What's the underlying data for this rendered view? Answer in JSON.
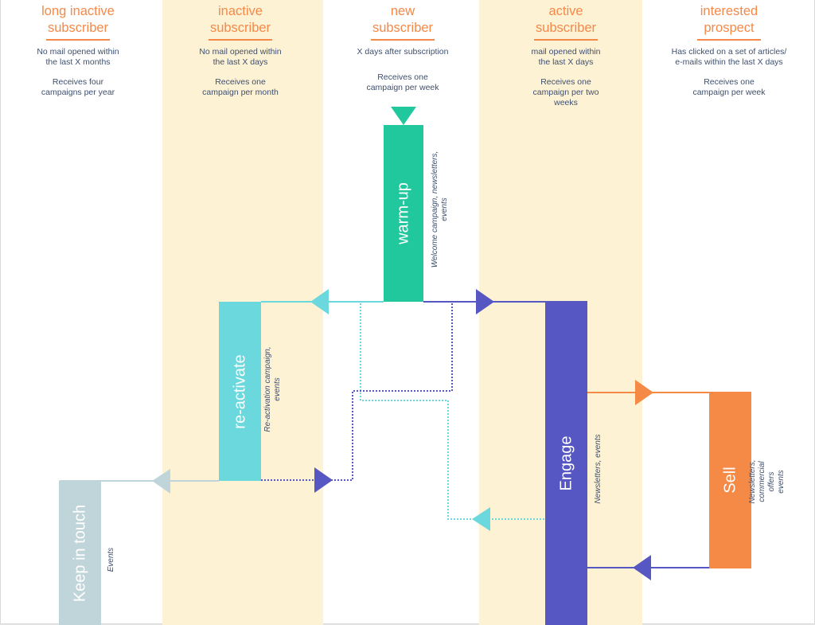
{
  "colors": {
    "lane_highlight": "#fef2d4",
    "title_orange": "#f4894a",
    "text_navy": "#3d4f6f",
    "warmup_green": "#22c89d",
    "reactivate_cyan": "#6ad8dc",
    "engage_purple": "#5657c2",
    "sell_orange": "#f48a45",
    "keep_grey": "#c0d5da"
  },
  "lanes": [
    {
      "id": "long-inactive",
      "title": "long inactive\nsubscriber",
      "title_l1": "long inactive",
      "title_l2": "subscriber",
      "criteria": "No mail opened within\nthe last X months",
      "frequency": "Receives four\ncampaigns per year"
    },
    {
      "id": "inactive",
      "title_l1": "inactive",
      "title_l2": "subscriber",
      "criteria": "No mail opened within\nthe last X days",
      "frequency": "Receives one\ncampaign per month"
    },
    {
      "id": "new",
      "title_l1": "new",
      "title_l2": "subscriber",
      "criteria": "X days after subscription",
      "frequency": "Receives one\ncampaign per week"
    },
    {
      "id": "active",
      "title_l1": "active",
      "title_l2": "subscriber",
      "criteria": "mail opened within\nthe last X days",
      "frequency": "Receives one\ncampaign per two\nweeks"
    },
    {
      "id": "interested",
      "title_l1": "interested",
      "title_l2": "prospect",
      "criteria": "Has clicked on a set of articles/\ne-mails within the last X days",
      "frequency": "Receives one\ncampaign per week"
    }
  ],
  "stages": {
    "warmup": {
      "label": "warm-up",
      "note": "Welcome campaign, newsletters,\nevents"
    },
    "reactivate": {
      "label": "re-activate",
      "note": "Re-activation campaign,\nevents"
    },
    "engage": {
      "label": "Engage",
      "note": "Newsletters,  events"
    },
    "sell": {
      "label": "Sell",
      "note": "Newsletters,  commercial offers\nevents"
    },
    "keep": {
      "label": "Keep in touch",
      "note": "Events"
    }
  },
  "flows": [
    {
      "from": "entry",
      "to": "warm-up",
      "style": "arrow-in"
    },
    {
      "from": "warm-up",
      "to": "re-activate",
      "style": "solid"
    },
    {
      "from": "warm-up",
      "to": "engage",
      "style": "solid"
    },
    {
      "from": "warm-up",
      "to": "re-activate",
      "style": "dotted"
    },
    {
      "from": "re-activate",
      "to": "engage",
      "style": "dotted"
    },
    {
      "from": "engage",
      "to": "re-activate",
      "style": "dotted"
    },
    {
      "from": "engage",
      "to": "sell",
      "style": "solid"
    },
    {
      "from": "sell",
      "to": "engage",
      "style": "solid"
    },
    {
      "from": "re-activate",
      "to": "keep-in-touch",
      "style": "solid"
    }
  ]
}
